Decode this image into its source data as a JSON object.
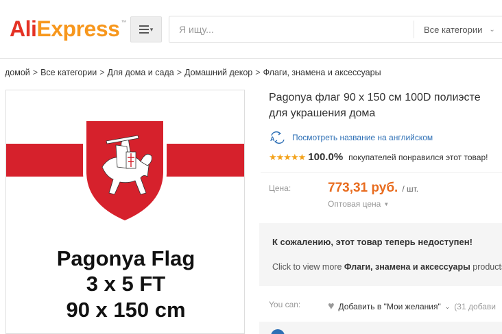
{
  "header": {
    "logo_main": "Ali",
    "logo_accent": "Express",
    "logo_tm": "™",
    "search_placeholder": "Я ищу...",
    "category_select": "Все категории"
  },
  "breadcrumb": [
    "домой",
    "Все категории",
    "Для дома и сада",
    "Домашний декор",
    "Флаги, знамена и аксессуары"
  ],
  "breadcrumb_sep": ">",
  "product": {
    "title_line1": "Pagonya флаг 90 x 150 см 100D полиэсте",
    "title_line2": "для украшения дома",
    "translate_link": "Посмотреть название на английском",
    "translate_icon_text": "А",
    "rating_stars": "★★★★★",
    "rating_pct": "100.0%",
    "rating_text": "покупателей понравился этот товар!",
    "price_label": "Цена:",
    "price": "773,31 руб.",
    "price_unit": "/ шт.",
    "wholesale": "Оптовая цена",
    "unavailable_title": "К сожалению, этот товар теперь недоступен!",
    "unavailable_prefix": "Click to view more",
    "unavailable_category": "Флаги, знамена и аксессуары",
    "unavailable_suffix": "products",
    "youcan_label": "You can:",
    "wishlist_label": "Добавить в \"Мои желания\"",
    "wishlist_count": "(31 добави"
  },
  "image": {
    "line1": "Pagonya Flag",
    "line2": "3 x 5 FT",
    "line3": "90 x 150 cm"
  },
  "colors": {
    "brand_red": "#e43225",
    "brand_orange": "#f7971d",
    "price_orange": "#e86c1f",
    "link_blue": "#2d6fb5",
    "flag_red": "#d6212c",
    "star": "#f3a21b"
  }
}
